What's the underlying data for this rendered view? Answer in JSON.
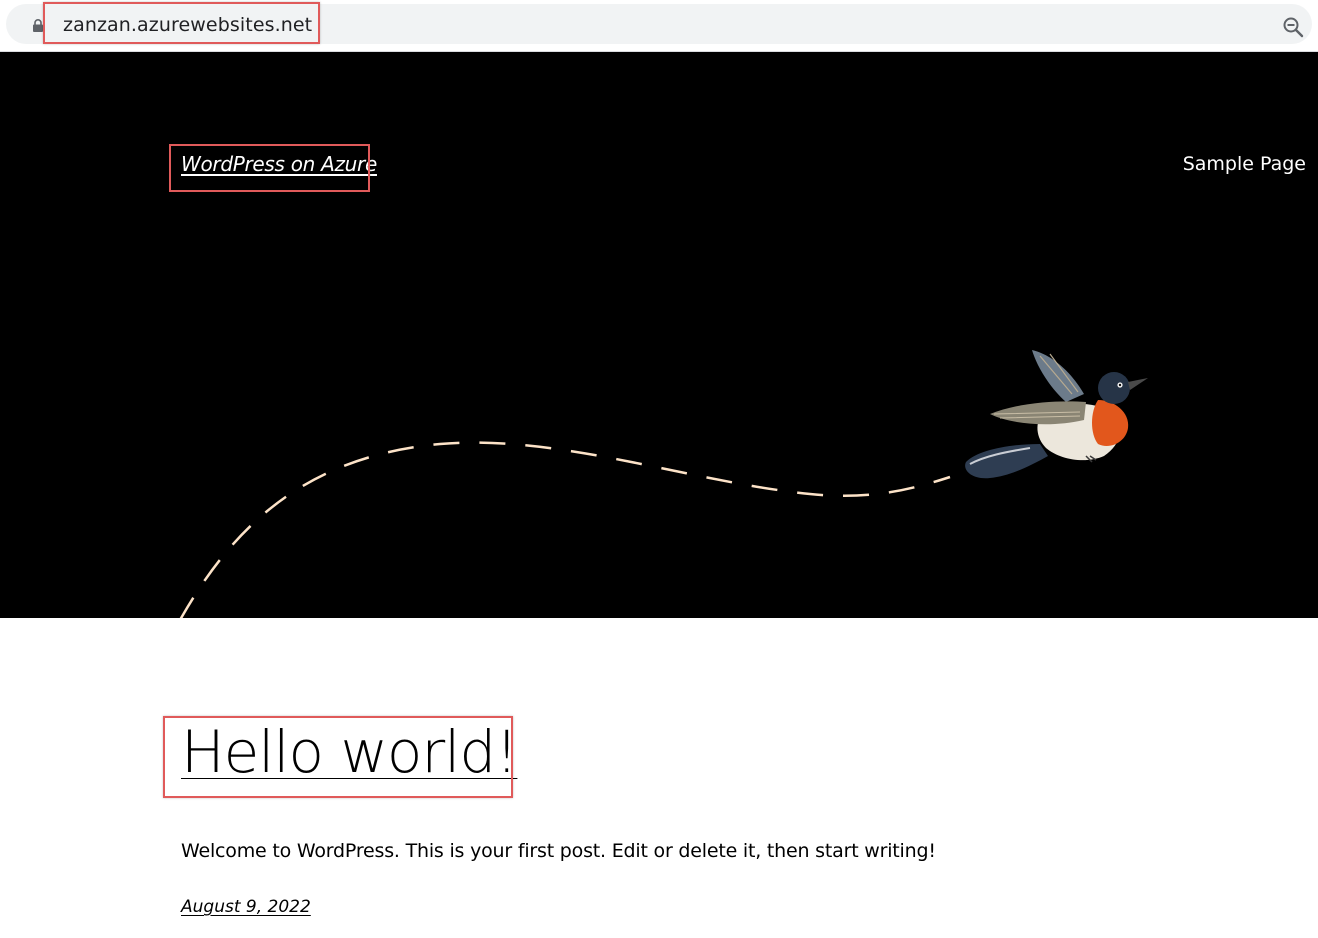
{
  "browser": {
    "url": "zanzan.azurewebsites.net",
    "lock_icon": "lock-icon",
    "zoom_icon": "zoom-out-icon"
  },
  "header": {
    "site_title": "WordPress on Azure",
    "nav": [
      {
        "label": "Sample Page"
      }
    ],
    "illustration": "flying-bird-icon",
    "background": "#000000",
    "path_color": "#fde3c8"
  },
  "post": {
    "title": "Hello world!",
    "excerpt": "Welcome to WordPress. This is your first post. Edit or delete it, then start writing!",
    "date": "August 9, 2022"
  },
  "highlight_color": "#e05a5a"
}
